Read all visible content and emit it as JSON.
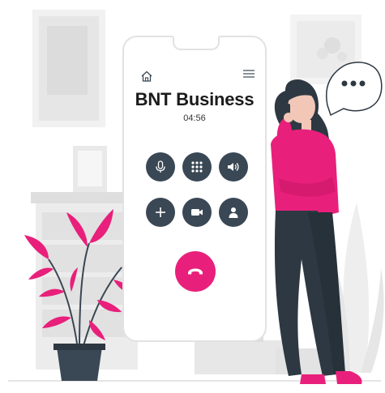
{
  "call": {
    "contact_name": "BNT Business",
    "duration": "04:56"
  },
  "colors": {
    "accent": "#e8207b",
    "button_dark": "#3a4754",
    "background_gray": "#ebebeb",
    "outline_gray": "#e2e2e2"
  },
  "icons": {
    "home": "home-icon",
    "menu": "menu-icon",
    "mute": "microphone-icon",
    "keypad": "keypad-icon",
    "speaker": "speaker-icon",
    "add_call": "plus-icon",
    "video": "video-camera-icon",
    "contacts": "contact-person-icon",
    "end_call": "end-call-icon",
    "speech_bubble": "ellipsis-icon"
  }
}
